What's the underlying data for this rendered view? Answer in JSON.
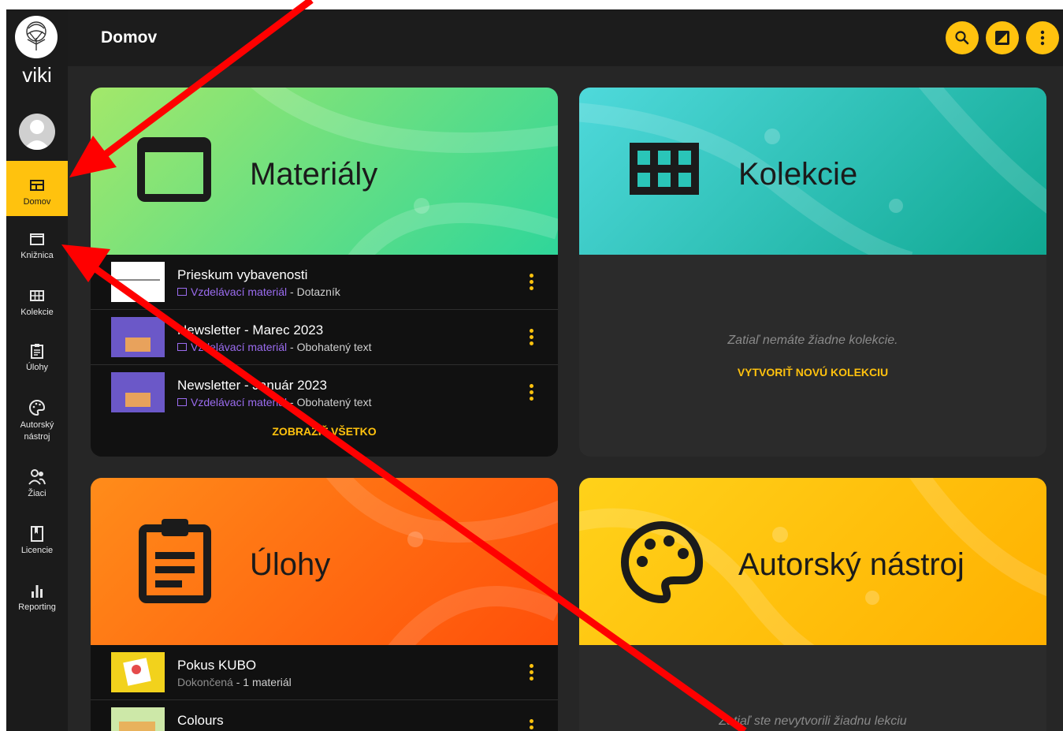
{
  "app": {
    "logo_text": "viki"
  },
  "header": {
    "title": "Domov"
  },
  "sidebar": {
    "items": [
      {
        "label": "Domov"
      },
      {
        "label": "Knižnica"
      },
      {
        "label": "Kolekcie"
      },
      {
        "label": "Úlohy"
      },
      {
        "label": "Autorský nástroj"
      },
      {
        "label": "Žiaci"
      },
      {
        "label": "Licencie"
      },
      {
        "label": "Reporting"
      }
    ]
  },
  "cards": {
    "materials": {
      "title": "Materiály",
      "rows": [
        {
          "title": "Prieskum vybavenosti",
          "type": "Vzdelávací materiál",
          "detail": " - Dotazník"
        },
        {
          "title": "Newsletter - Marec 2023",
          "type": "Vzdelávací materiál",
          "detail": " - Obohatený text"
        },
        {
          "title": "Newsletter - Január 2023",
          "type": "Vzdelávací materiál",
          "detail": " - Obohatený text"
        }
      ],
      "link": "ZOBRAZIŤ VŠETKO"
    },
    "collections": {
      "title": "Kolekcie",
      "empty": "Zatiaľ nemáte žiadne kolekcie.",
      "link": "VYTVORIŤ NOVÚ KOLEKCIU"
    },
    "tasks": {
      "title": "Úlohy",
      "rows": [
        {
          "title": "Pokus KUBO",
          "status": "Dokončená",
          "detail": " - 1 materiál"
        },
        {
          "title": "Colours"
        }
      ]
    },
    "authoring": {
      "title": "Autorský nástroj",
      "empty": "Zatiaľ ste nevytvorili žiadnu lekciu"
    }
  },
  "colors": {
    "accent": "#ffc20e",
    "sidebar_bg": "#1b1b1b",
    "materials_gradient": [
      "#a3e86a",
      "#2fd69a"
    ],
    "collections_gradient": [
      "#4fd9db",
      "#10a892"
    ],
    "tasks_gradient": [
      "#ff8c1a",
      "#ff4f0a"
    ],
    "authoring_gradient": [
      "#ffd21a",
      "#ffb000"
    ],
    "annotation_arrow": "#ff0000"
  },
  "icons": {
    "header": [
      "search-icon",
      "lightbox-icon",
      "more-vertical-icon"
    ],
    "sidebar": [
      "dashboard-icon",
      "book-icon",
      "grid-icon",
      "clipboard-icon",
      "palette-icon",
      "people-icon",
      "license-icon",
      "bar-chart-icon"
    ]
  }
}
